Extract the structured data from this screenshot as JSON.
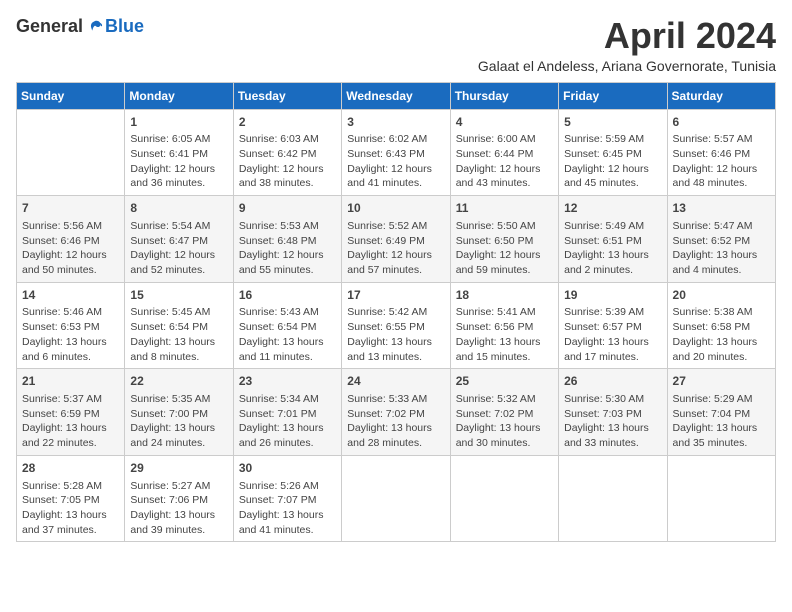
{
  "logo": {
    "general": "General",
    "blue": "Blue"
  },
  "title": "April 2024",
  "subtitle": "Galaat el Andeless, Ariana Governorate, Tunisia",
  "headers": [
    "Sunday",
    "Monday",
    "Tuesday",
    "Wednesday",
    "Thursday",
    "Friday",
    "Saturday"
  ],
  "weeks": [
    [
      {
        "day": "",
        "info": ""
      },
      {
        "day": "1",
        "info": "Sunrise: 6:05 AM\nSunset: 6:41 PM\nDaylight: 12 hours\nand 36 minutes."
      },
      {
        "day": "2",
        "info": "Sunrise: 6:03 AM\nSunset: 6:42 PM\nDaylight: 12 hours\nand 38 minutes."
      },
      {
        "day": "3",
        "info": "Sunrise: 6:02 AM\nSunset: 6:43 PM\nDaylight: 12 hours\nand 41 minutes."
      },
      {
        "day": "4",
        "info": "Sunrise: 6:00 AM\nSunset: 6:44 PM\nDaylight: 12 hours\nand 43 minutes."
      },
      {
        "day": "5",
        "info": "Sunrise: 5:59 AM\nSunset: 6:45 PM\nDaylight: 12 hours\nand 45 minutes."
      },
      {
        "day": "6",
        "info": "Sunrise: 5:57 AM\nSunset: 6:46 PM\nDaylight: 12 hours\nand 48 minutes."
      }
    ],
    [
      {
        "day": "7",
        "info": "Sunrise: 5:56 AM\nSunset: 6:46 PM\nDaylight: 12 hours\nand 50 minutes."
      },
      {
        "day": "8",
        "info": "Sunrise: 5:54 AM\nSunset: 6:47 PM\nDaylight: 12 hours\nand 52 minutes."
      },
      {
        "day": "9",
        "info": "Sunrise: 5:53 AM\nSunset: 6:48 PM\nDaylight: 12 hours\nand 55 minutes."
      },
      {
        "day": "10",
        "info": "Sunrise: 5:52 AM\nSunset: 6:49 PM\nDaylight: 12 hours\nand 57 minutes."
      },
      {
        "day": "11",
        "info": "Sunrise: 5:50 AM\nSunset: 6:50 PM\nDaylight: 12 hours\nand 59 minutes."
      },
      {
        "day": "12",
        "info": "Sunrise: 5:49 AM\nSunset: 6:51 PM\nDaylight: 13 hours\nand 2 minutes."
      },
      {
        "day": "13",
        "info": "Sunrise: 5:47 AM\nSunset: 6:52 PM\nDaylight: 13 hours\nand 4 minutes."
      }
    ],
    [
      {
        "day": "14",
        "info": "Sunrise: 5:46 AM\nSunset: 6:53 PM\nDaylight: 13 hours\nand 6 minutes."
      },
      {
        "day": "15",
        "info": "Sunrise: 5:45 AM\nSunset: 6:54 PM\nDaylight: 13 hours\nand 8 minutes."
      },
      {
        "day": "16",
        "info": "Sunrise: 5:43 AM\nSunset: 6:54 PM\nDaylight: 13 hours\nand 11 minutes."
      },
      {
        "day": "17",
        "info": "Sunrise: 5:42 AM\nSunset: 6:55 PM\nDaylight: 13 hours\nand 13 minutes."
      },
      {
        "day": "18",
        "info": "Sunrise: 5:41 AM\nSunset: 6:56 PM\nDaylight: 13 hours\nand 15 minutes."
      },
      {
        "day": "19",
        "info": "Sunrise: 5:39 AM\nSunset: 6:57 PM\nDaylight: 13 hours\nand 17 minutes."
      },
      {
        "day": "20",
        "info": "Sunrise: 5:38 AM\nSunset: 6:58 PM\nDaylight: 13 hours\nand 20 minutes."
      }
    ],
    [
      {
        "day": "21",
        "info": "Sunrise: 5:37 AM\nSunset: 6:59 PM\nDaylight: 13 hours\nand 22 minutes."
      },
      {
        "day": "22",
        "info": "Sunrise: 5:35 AM\nSunset: 7:00 PM\nDaylight: 13 hours\nand 24 minutes."
      },
      {
        "day": "23",
        "info": "Sunrise: 5:34 AM\nSunset: 7:01 PM\nDaylight: 13 hours\nand 26 minutes."
      },
      {
        "day": "24",
        "info": "Sunrise: 5:33 AM\nSunset: 7:02 PM\nDaylight: 13 hours\nand 28 minutes."
      },
      {
        "day": "25",
        "info": "Sunrise: 5:32 AM\nSunset: 7:02 PM\nDaylight: 13 hours\nand 30 minutes."
      },
      {
        "day": "26",
        "info": "Sunrise: 5:30 AM\nSunset: 7:03 PM\nDaylight: 13 hours\nand 33 minutes."
      },
      {
        "day": "27",
        "info": "Sunrise: 5:29 AM\nSunset: 7:04 PM\nDaylight: 13 hours\nand 35 minutes."
      }
    ],
    [
      {
        "day": "28",
        "info": "Sunrise: 5:28 AM\nSunset: 7:05 PM\nDaylight: 13 hours\nand 37 minutes."
      },
      {
        "day": "29",
        "info": "Sunrise: 5:27 AM\nSunset: 7:06 PM\nDaylight: 13 hours\nand 39 minutes."
      },
      {
        "day": "30",
        "info": "Sunrise: 5:26 AM\nSunset: 7:07 PM\nDaylight: 13 hours\nand 41 minutes."
      },
      {
        "day": "",
        "info": ""
      },
      {
        "day": "",
        "info": ""
      },
      {
        "day": "",
        "info": ""
      },
      {
        "day": "",
        "info": ""
      }
    ]
  ]
}
